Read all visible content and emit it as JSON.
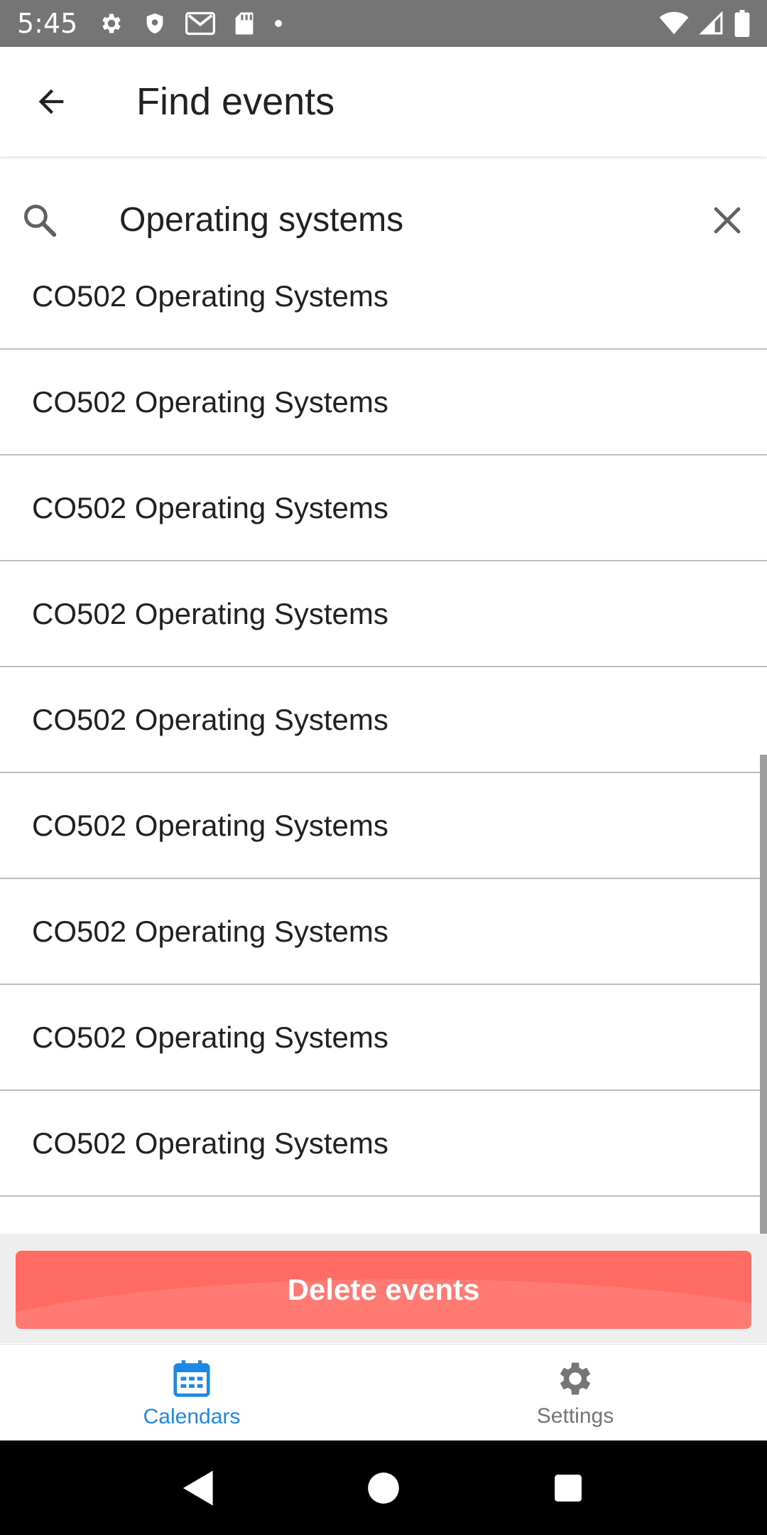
{
  "status_bar": {
    "time": "5:45",
    "icons_left": [
      "settings-icon",
      "shield-icon",
      "gmail-icon",
      "sd-card-icon",
      "dot-icon"
    ],
    "icons_right": [
      "wifi-icon",
      "signal-icon",
      "battery-icon"
    ]
  },
  "app_bar": {
    "title": "Find events",
    "back_icon": "arrow-back-icon"
  },
  "search": {
    "value": "Operating systems",
    "placeholder": "",
    "search_icon": "search-icon",
    "clear_icon": "close-icon"
  },
  "results": [
    {
      "label": "CO502 Operating Systems"
    },
    {
      "label": "CO502 Operating Systems"
    },
    {
      "label": "CO502 Operating Systems"
    },
    {
      "label": "CO502 Operating Systems"
    },
    {
      "label": "CO502 Operating Systems"
    },
    {
      "label": "CO502 Operating Systems"
    },
    {
      "label": "CO502 Operating Systems"
    },
    {
      "label": "CO502 Operating Systems"
    },
    {
      "label": "CO502 Operating Systems"
    }
  ],
  "delete_button": {
    "label": "Delete events",
    "color": "#ff6b62"
  },
  "bottom_nav": {
    "items": [
      {
        "label": "Calendars",
        "icon": "calendar-icon",
        "active": true
      },
      {
        "label": "Settings",
        "icon": "gear-icon",
        "active": false
      }
    ],
    "active_color": "#1e88e5",
    "inactive_color": "#757575"
  },
  "system_nav": {
    "back_icon": "triangle-back-icon",
    "home_icon": "circle-home-icon",
    "recents_icon": "square-recents-icon"
  }
}
